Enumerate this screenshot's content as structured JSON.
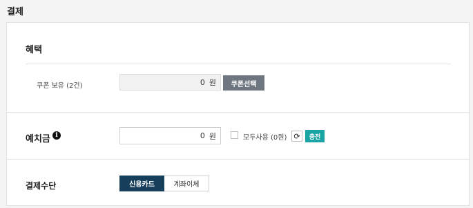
{
  "page": {
    "title": "결제"
  },
  "benefit": {
    "title": "혜택",
    "coupon_label": "쿠폰 보유 (2건)",
    "coupon_amount": "0",
    "currency": "원",
    "coupon_button": "쿠폰선택"
  },
  "deposit": {
    "title": "예치금",
    "info_icon": "info-circle-icon",
    "amount": "0",
    "currency": "원",
    "use_all_label": "모두사용 (0원)",
    "refresh_icon": "refresh-icon",
    "refresh_glyph": "⟳",
    "charge_button": "충전"
  },
  "payment": {
    "title": "결제수단",
    "methods": [
      {
        "label": "신용카드",
        "selected": true
      },
      {
        "label": "계좌이체",
        "selected": false
      }
    ]
  },
  "colors": {
    "coupon_button": "#6e7780",
    "charge_button": "#1aa5a5",
    "selected_tab": "#173f5c"
  }
}
